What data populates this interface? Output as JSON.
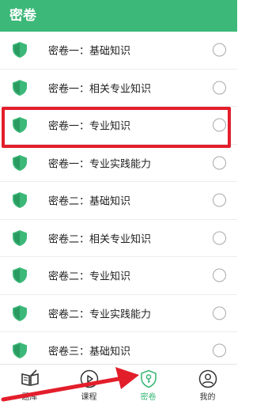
{
  "header": {
    "title": "密卷"
  },
  "colors": {
    "accent": "#3cb878",
    "annotation": "#e31e2b"
  },
  "list": {
    "items": [
      {
        "label": "密卷一：基础知识"
      },
      {
        "label": "密卷一：相关专业知识"
      },
      {
        "label": "密卷一：专业知识"
      },
      {
        "label": "密卷一：专业实践能力"
      },
      {
        "label": "密卷二：基础知识"
      },
      {
        "label": "密卷二：相关专业知识"
      },
      {
        "label": "密卷二：专业知识"
      },
      {
        "label": "密卷二：专业实践能力"
      },
      {
        "label": "密卷三：基础知识"
      }
    ]
  },
  "tabbar": {
    "tabs": [
      {
        "label": "题库",
        "icon": "book-icon"
      },
      {
        "label": "课程",
        "icon": "play-icon"
      },
      {
        "label": "密卷",
        "icon": "shield-key-icon",
        "active": true
      },
      {
        "label": "我的",
        "icon": "user-icon"
      }
    ]
  }
}
